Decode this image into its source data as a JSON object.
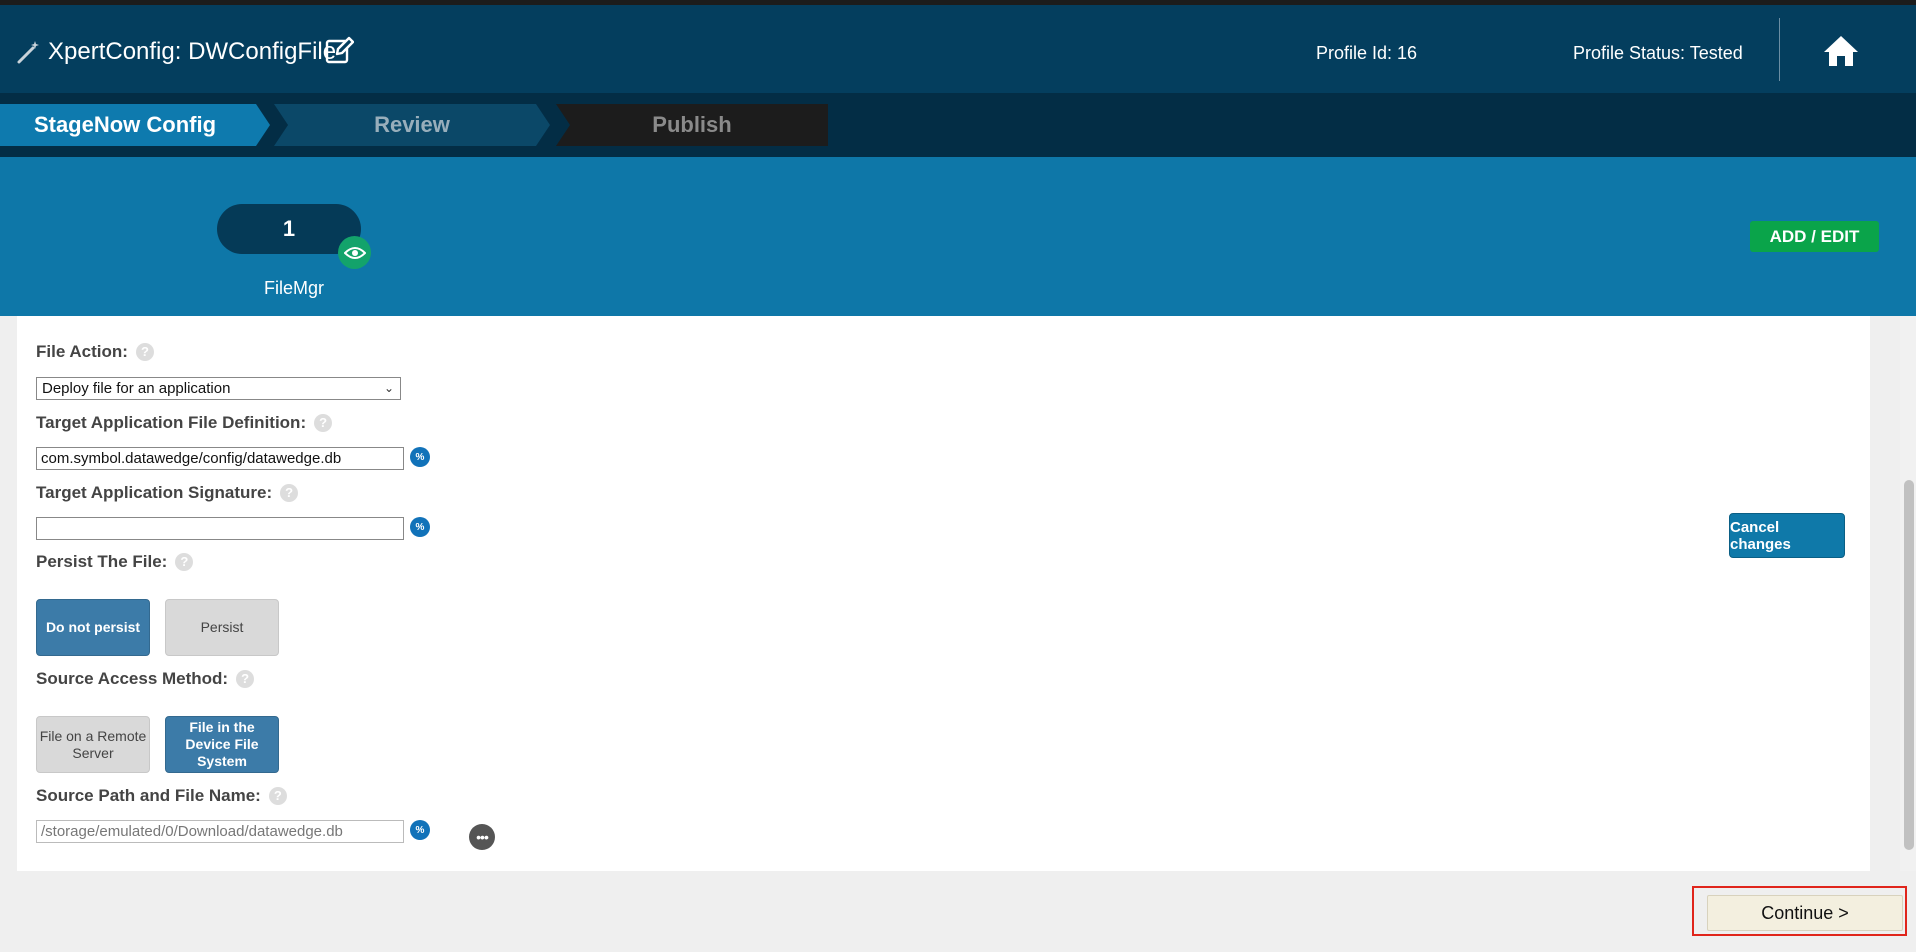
{
  "header": {
    "title": "XpertConfig: DWConfigFile",
    "profile_id": "Profile Id: 16",
    "profile_status": "Profile Status: Tested"
  },
  "steps": [
    {
      "label": "StageNow Config",
      "state": "active"
    },
    {
      "label": "Review",
      "state": "pending"
    },
    {
      "label": "Publish",
      "state": "disabled"
    }
  ],
  "band": {
    "step_number": "1",
    "step_name": "FileMgr",
    "add_edit_label": "ADD / EDIT"
  },
  "form": {
    "file_action": {
      "label": "File Action:",
      "selected": "Deploy file for an application"
    },
    "target_def": {
      "label": "Target Application File Definition:",
      "value": "com.symbol.datawedge/config/datawedge.db"
    },
    "target_sig": {
      "label": "Target Application Signature:",
      "value": ""
    },
    "persist": {
      "label": "Persist The File:",
      "options": [
        "Do not persist",
        "Persist"
      ],
      "selected": "Do not persist"
    },
    "source_method": {
      "label": "Source Access Method:",
      "options": [
        "File on a Remote Server",
        "File in the Device File System"
      ],
      "selected": "File in the Device File System"
    },
    "source_path": {
      "label": "Source Path and File Name:",
      "value": "/storage/emulated/0/Download/datawedge.db"
    },
    "help_glyph": "?",
    "percent_glyph": "%",
    "dots_glyph": "•••"
  },
  "buttons": {
    "cancel": "Cancel changes",
    "continue": "Continue  >"
  },
  "colors": {
    "header_bg": "#043e5e",
    "band_bg": "#0e77a8",
    "active_step": "#0e7aae",
    "add_edit": "#0aa44a",
    "eye_badge": "#13a36b",
    "highlight_outline": "#e0251b"
  },
  "icons": {
    "title_icon": "magic-wand-icon",
    "edit": "edit-pencil-icon",
    "home": "home-icon",
    "eye": "eye-icon",
    "more": "more-dots-icon",
    "variable": "percent-icon",
    "help": "question-icon"
  }
}
